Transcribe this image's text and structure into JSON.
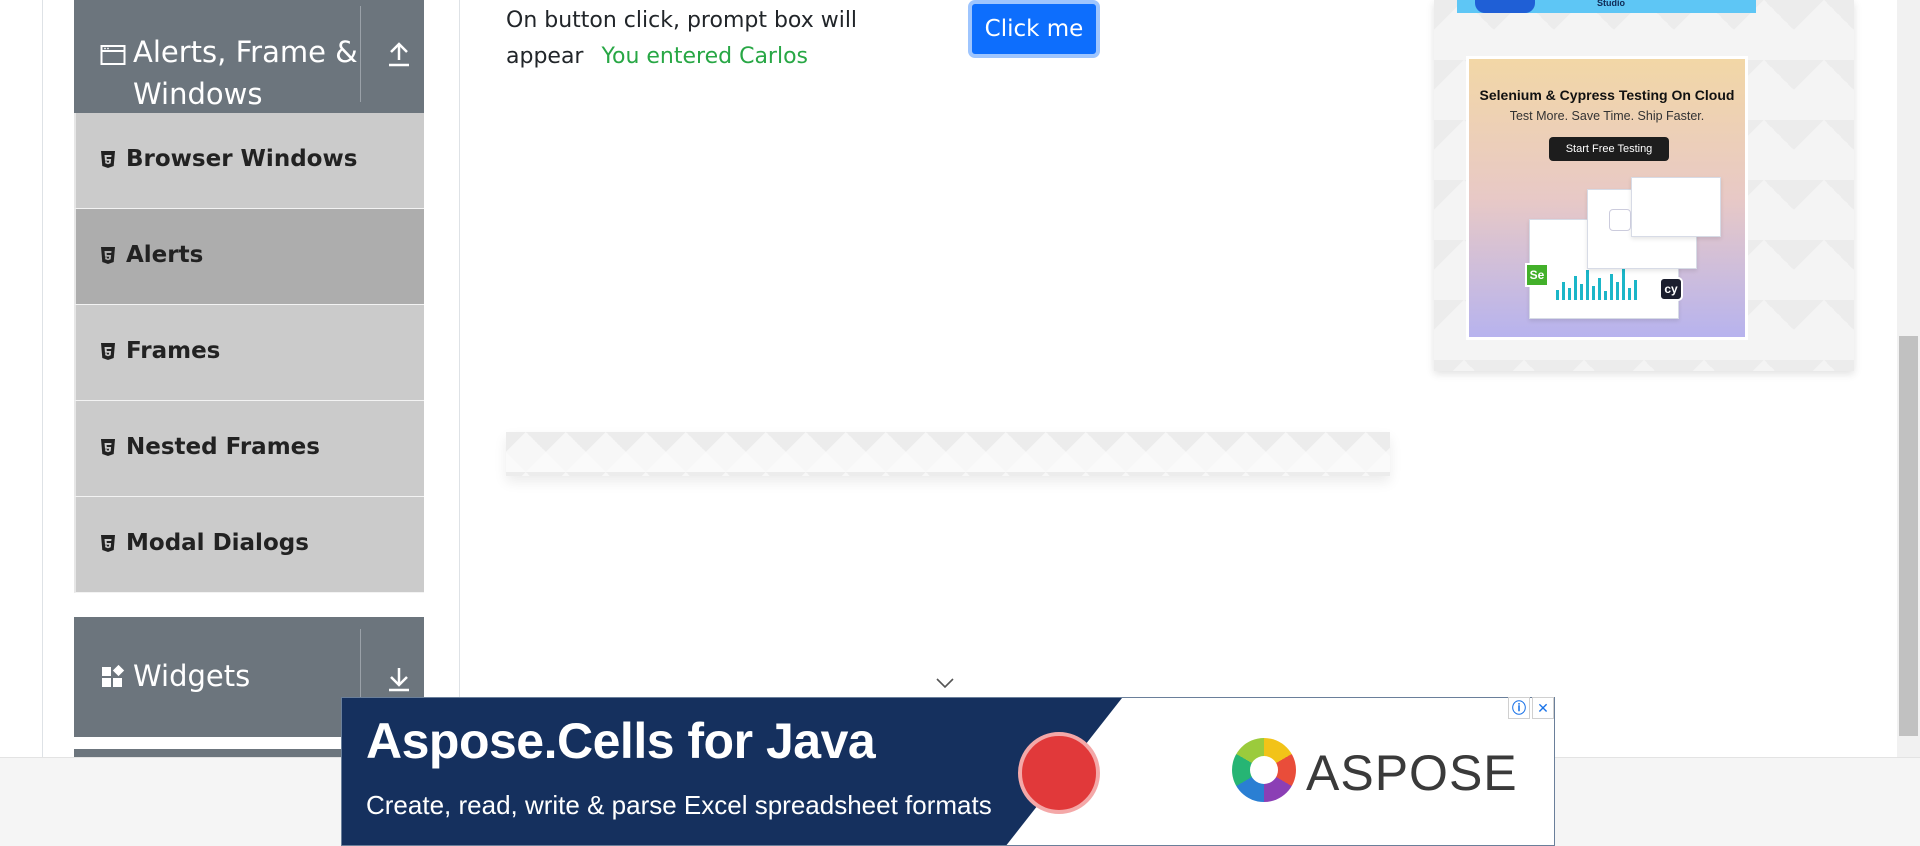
{
  "sidebar": {
    "alerts_group": {
      "title_line1": "Alerts, Frame &",
      "title_line2": "Windows"
    },
    "items": [
      {
        "label": "Browser Windows",
        "active": false
      },
      {
        "label": "Alerts",
        "active": true
      },
      {
        "label": "Frames",
        "active": false
      },
      {
        "label": "Nested Frames",
        "active": false
      },
      {
        "label": "Modal Dialogs",
        "active": false
      }
    ],
    "widgets_group": {
      "title": "Widgets"
    }
  },
  "main": {
    "prompt_description": "On button click, prompt box will appear",
    "prompt_result": "You entered Carlos",
    "click_button_label": "Click me"
  },
  "right_ad": {
    "top_strip_text": "Studio",
    "title": "Selenium & Cypress Testing On Cloud",
    "subtitle": "Test More. Save Time. Ship Faster.",
    "button_label": "Start Free Testing",
    "badge_se": "Se",
    "badge_cy": "cy"
  },
  "bottom_ad": {
    "title": "Aspose.Cells for Java",
    "subtitle": "Create, read, write & parse Excel spreadsheet formats",
    "brand": "ASPOSE",
    "info_icon": "ⓘ",
    "close_icon": "✕"
  },
  "colors": {
    "sidebar_header": "#6c757d",
    "menu_item": "#cbcbcb",
    "menu_item_active": "#adadad",
    "primary_button": "#0d6efd",
    "success_text": "#28a745"
  }
}
